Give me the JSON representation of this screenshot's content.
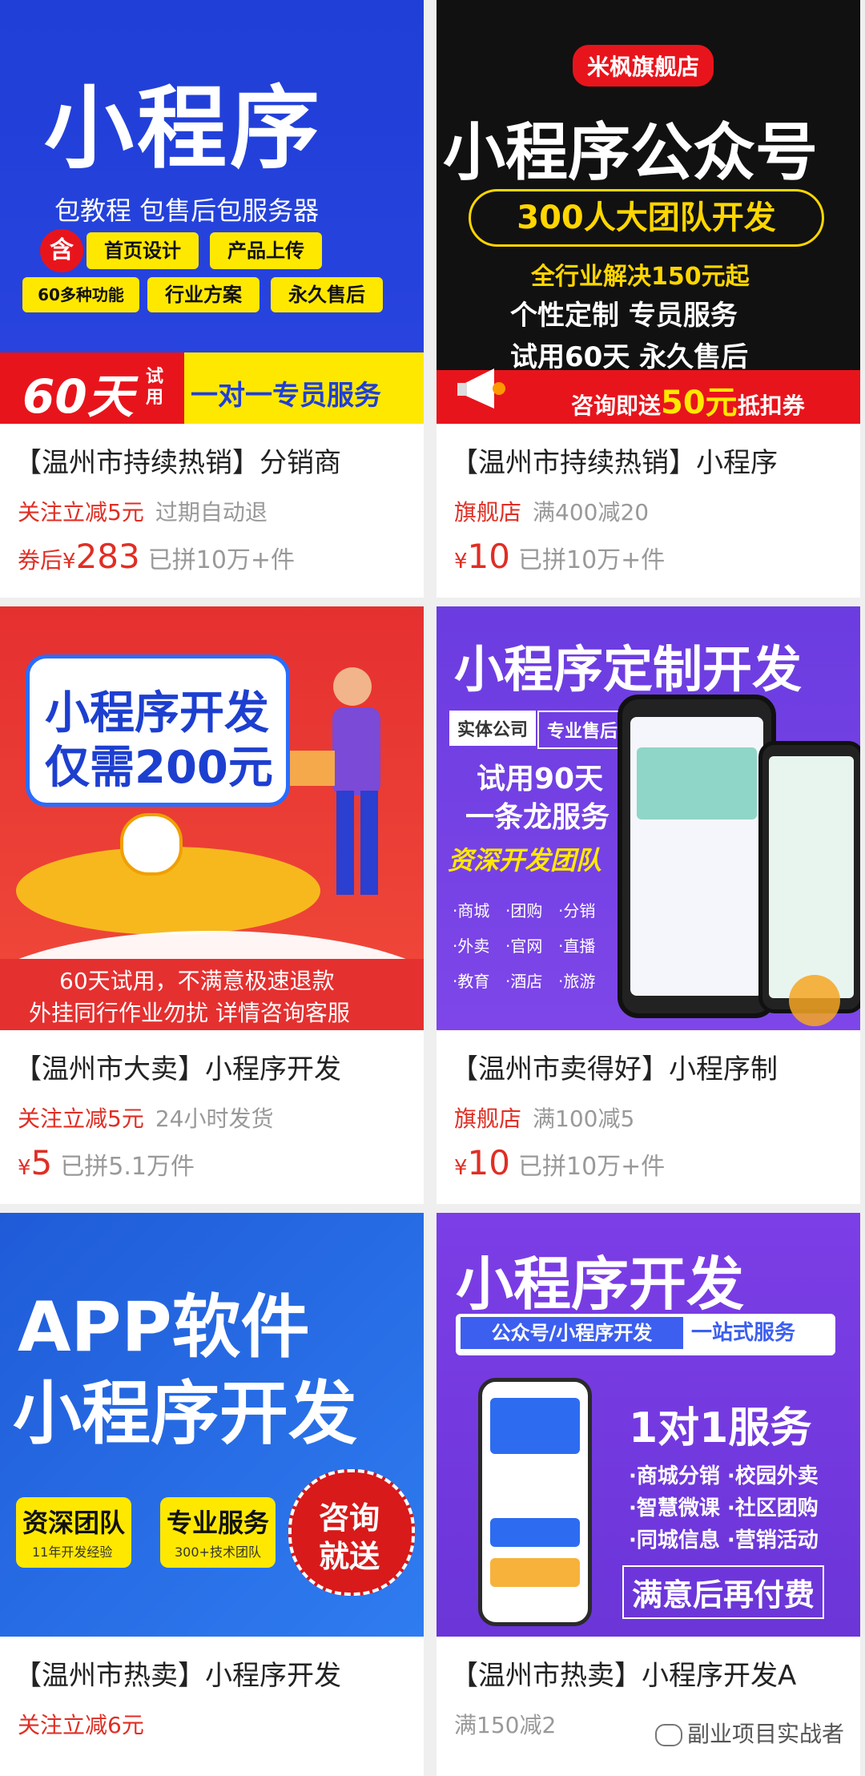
{
  "products": [
    {
      "banner": {
        "headline": "小程序",
        "sub": "包教程 包售后包服务器",
        "badge": "含",
        "tags": [
          "首页设计",
          "产品上传",
          "60多种功能",
          "行业方案",
          "永久售后"
        ],
        "footer_days": "60天",
        "footer_trial": "试用",
        "footer_service": "一对一专员服务"
      },
      "title": "【温州市持续热销】分销商",
      "promo_red": "关注立减5元",
      "promo_gray": "过期自动退",
      "price_prefix": "券后",
      "currency": "¥",
      "price": "283",
      "sold": "已拼10万+件"
    },
    {
      "banner": {
        "store": "米枫旗舰店",
        "headline": "小程序公众号",
        "pill": "300人大团队开发",
        "l1": "全行业解决150元起",
        "l2": "个性定制  专员服务",
        "l3": "试用60天  永久售后",
        "footer": "咨询即送",
        "footer_amt": "50元",
        "footer_tail": "抵扣券"
      },
      "title": "【温州市持续热销】小程序",
      "promo_red": "旗舰店",
      "promo_gray": "满400减20",
      "price_prefix": "",
      "currency": "¥",
      "price": "10",
      "sold": "已拼10万+件"
    },
    {
      "banner": {
        "l1": "小程序开发",
        "l2": "仅需200元",
        "b1": "60天试用，不满意极速退款",
        "b2": "外挂同行作业勿扰 详情咨询客服"
      },
      "title": "【温州市大卖】小程序开发",
      "promo_red": "关注立减5元",
      "promo_gray": "24小时发货",
      "price_prefix": "",
      "currency": "¥",
      "price": "5",
      "sold": "已拼5.1万件"
    },
    {
      "banner": {
        "headline": "小程序定制开发",
        "tag1": "实体公司",
        "tag2": "专业售后",
        "l1": "试用90天",
        "l2": "一条龙服务",
        "l3": "资深开发团队",
        "items": [
          "·商城",
          "·团购",
          "·分销",
          "·外卖",
          "·官网",
          "·直播",
          "·教育",
          "·酒店",
          "·旅游"
        ]
      },
      "title": "【温州市卖得好】小程序制",
      "promo_red": "旗舰店",
      "promo_gray": "满100减5",
      "price_prefix": "",
      "currency": "¥",
      "price": "10",
      "sold": "已拼10万+件"
    },
    {
      "banner": {
        "l1": "APP软件",
        "l2": "小程序开发",
        "box1_title": "资深团队",
        "box1_sub": "11年开发经验",
        "box2_title": "专业服务",
        "box2_sub": "300+技术团队",
        "seal1": "咨询",
        "seal2": "就送"
      },
      "title": "【温州市热卖】小程序开发",
      "promo_red": "关注立减6元",
      "promo_gray": ""
    },
    {
      "banner": {
        "headline": "小程序开发",
        "strip_left": "公众号/小程序开发",
        "strip_right": "一站式服务",
        "big": "1对1服务",
        "f1": "·商城分销 ·校园外卖",
        "f2": "·智慧微课 ·社区团购",
        "f3": "·同城信息 ·营销活动",
        "bottom": "满意后再付费"
      },
      "title": "【温州市热卖】小程序开发A",
      "promo_red": "",
      "promo_gray": "满150减2"
    }
  ],
  "watermark": "副业项目实战者",
  "colors": {
    "price_red": "#e02e24",
    "muted": "#999999",
    "page_bg": "#efefef"
  }
}
